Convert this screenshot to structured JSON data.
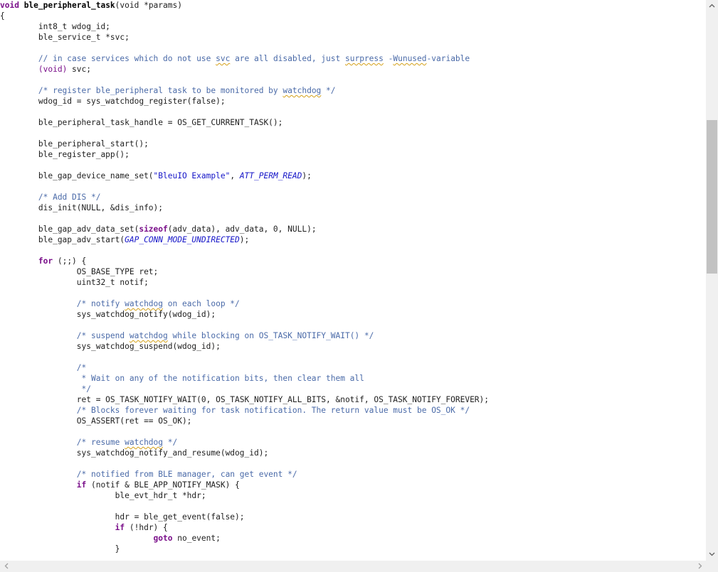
{
  "editor": {
    "lines": [
      [
        [
          "void ",
          "kwb"
        ],
        [
          "ble_peripheral_task",
          "fnb"
        ],
        [
          "(void *params)",
          ""
        ]
      ],
      [
        [
          "{",
          ""
        ]
      ],
      [
        [
          "        int8_t wdog_id;",
          ""
        ]
      ],
      [
        [
          "        ble_service_t *svc;",
          ""
        ]
      ],
      [],
      [
        [
          "        // in case services which do not use ",
          "cm"
        ],
        [
          "svc",
          "cm spell"
        ],
        [
          " are all disabled, just ",
          "cm"
        ],
        [
          "surpress",
          "cm spell"
        ],
        [
          " -",
          "cm"
        ],
        [
          "Wunused",
          "cm spell"
        ],
        [
          "-variable",
          "cm"
        ]
      ],
      [
        [
          "        ",
          ""
        ],
        [
          "(void)",
          "kw"
        ],
        [
          " svc;",
          ""
        ]
      ],
      [],
      [
        [
          "        /* register ble_peripheral task to be monitored by ",
          "cm"
        ],
        [
          "watchdog",
          "cm spell"
        ],
        [
          " */",
          "cm"
        ]
      ],
      [
        [
          "        wdog_id = sys_watchdog_register(false);",
          ""
        ]
      ],
      [],
      [
        [
          "        ble_peripheral_task_handle = OS_GET_CURRENT_TASK();",
          ""
        ]
      ],
      [],
      [
        [
          "        ble_peripheral_start();",
          ""
        ]
      ],
      [
        [
          "        ble_register_app();",
          ""
        ]
      ],
      [],
      [
        [
          "        ble_gap_device_name_set(",
          ""
        ],
        [
          "\"BleuIO Example\"",
          "str"
        ],
        [
          ", ",
          ""
        ],
        [
          "ATT_PERM_READ",
          "mac"
        ],
        [
          ");",
          ""
        ]
      ],
      [],
      [
        [
          "        /* Add DIS */",
          "cm"
        ]
      ],
      [
        [
          "        dis_init(NULL, &dis_info);",
          ""
        ]
      ],
      [],
      [
        [
          "        ble_gap_adv_data_set(",
          ""
        ],
        [
          "sizeof",
          "kwb"
        ],
        [
          "(adv_data), adv_data, 0, NULL);",
          ""
        ]
      ],
      [
        [
          "        ble_gap_adv_start(",
          ""
        ],
        [
          "GAP_CONN_MODE_UNDIRECTED",
          "mac"
        ],
        [
          ");",
          ""
        ]
      ],
      [],
      [
        [
          "        ",
          ""
        ],
        [
          "for",
          "kwb"
        ],
        [
          " (;;) {",
          ""
        ]
      ],
      [
        [
          "                OS_BASE_TYPE ret;",
          ""
        ]
      ],
      [
        [
          "                uint32_t notif;",
          ""
        ]
      ],
      [],
      [
        [
          "                /* notify ",
          "cm"
        ],
        [
          "watchdog",
          "cm spell"
        ],
        [
          " on each loop */",
          "cm"
        ]
      ],
      [
        [
          "                sys_watchdog_notify(wdog_id);",
          ""
        ]
      ],
      [],
      [
        [
          "                /* suspend ",
          "cm"
        ],
        [
          "watchdog",
          "cm spell"
        ],
        [
          " while blocking on OS_TASK_NOTIFY_WAIT() */",
          "cm"
        ]
      ],
      [
        [
          "                sys_watchdog_suspend(wdog_id);",
          ""
        ]
      ],
      [],
      [
        [
          "                /*",
          "cm"
        ]
      ],
      [
        [
          "                 * Wait on any of the notification bits, then clear them all",
          "cm"
        ]
      ],
      [
        [
          "                 */",
          "cm"
        ]
      ],
      [
        [
          "                ret = OS_TASK_NOTIFY_WAIT(0, OS_TASK_NOTIFY_ALL_BITS, &notif, OS_TASK_NOTIFY_FOREVER);",
          ""
        ]
      ],
      [
        [
          "                /* Blocks forever waiting for task notification. The return value must be OS_OK */",
          "cm"
        ]
      ],
      [
        [
          "                OS_ASSERT(ret == OS_OK);",
          ""
        ]
      ],
      [],
      [
        [
          "                /* resume ",
          "cm"
        ],
        [
          "watchdog",
          "cm spell"
        ],
        [
          " */",
          "cm"
        ]
      ],
      [
        [
          "                sys_watchdog_notify_and_resume(wdog_id);",
          ""
        ]
      ],
      [],
      [
        [
          "                /* notified from BLE manager, can get event */",
          "cm"
        ]
      ],
      [
        [
          "                ",
          ""
        ],
        [
          "if",
          "kwb"
        ],
        [
          " (notif & BLE_APP_NOTIFY_MASK) {",
          ""
        ]
      ],
      [
        [
          "                        ble_evt_hdr_t *hdr;",
          ""
        ]
      ],
      [],
      [
        [
          "                        hdr = ble_get_event(false);",
          ""
        ]
      ],
      [
        [
          "                        ",
          ""
        ],
        [
          "if",
          "kwb"
        ],
        [
          " (!hdr) {",
          ""
        ]
      ],
      [
        [
          "                                ",
          ""
        ],
        [
          "goto",
          "kwb"
        ],
        [
          " no_event;",
          ""
        ]
      ],
      [
        [
          "                        }",
          ""
        ]
      ]
    ]
  },
  "scrollbars": {
    "vertical": {
      "up_arrow": "▲",
      "down_arrow": "▼",
      "position": 0.28
    },
    "horizontal": {
      "left_arrow": "◀",
      "right_arrow": "▶"
    }
  },
  "colors": {
    "keyword": "#7a0f8a",
    "comment": "#4a6aa8",
    "string": "#1515c8",
    "macro": "#1515c8",
    "spellcheck_underline": "#d4a017",
    "default_text": "#1e1e1e"
  }
}
